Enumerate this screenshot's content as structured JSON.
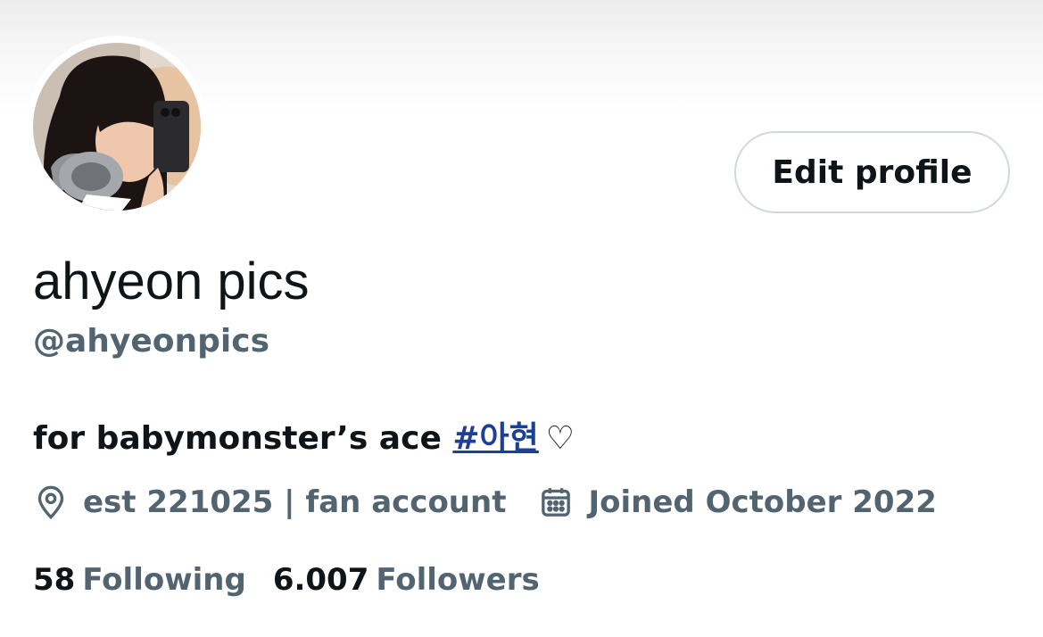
{
  "profile": {
    "display_name": "ahyeon pics",
    "handle": "@ahyeonpics",
    "bio_text": "for babymonster’s ace ",
    "bio_hashtag": "#아현",
    "bio_suffix": "♡",
    "location": "est 221025 | fan account",
    "joined": "Joined October 2022",
    "following_count": "58",
    "following_label": "Following",
    "followers_count": "6.007",
    "followers_label": "Followers"
  },
  "actions": {
    "edit_profile_label": "Edit profile"
  },
  "icons": {
    "location": "location-pin-icon",
    "joined": "calendar-icon"
  },
  "colors": {
    "primary_text": "#0f1419",
    "secondary_text": "#536471",
    "hashtag": "#1d3f95",
    "button_border": "#cfd9de"
  }
}
